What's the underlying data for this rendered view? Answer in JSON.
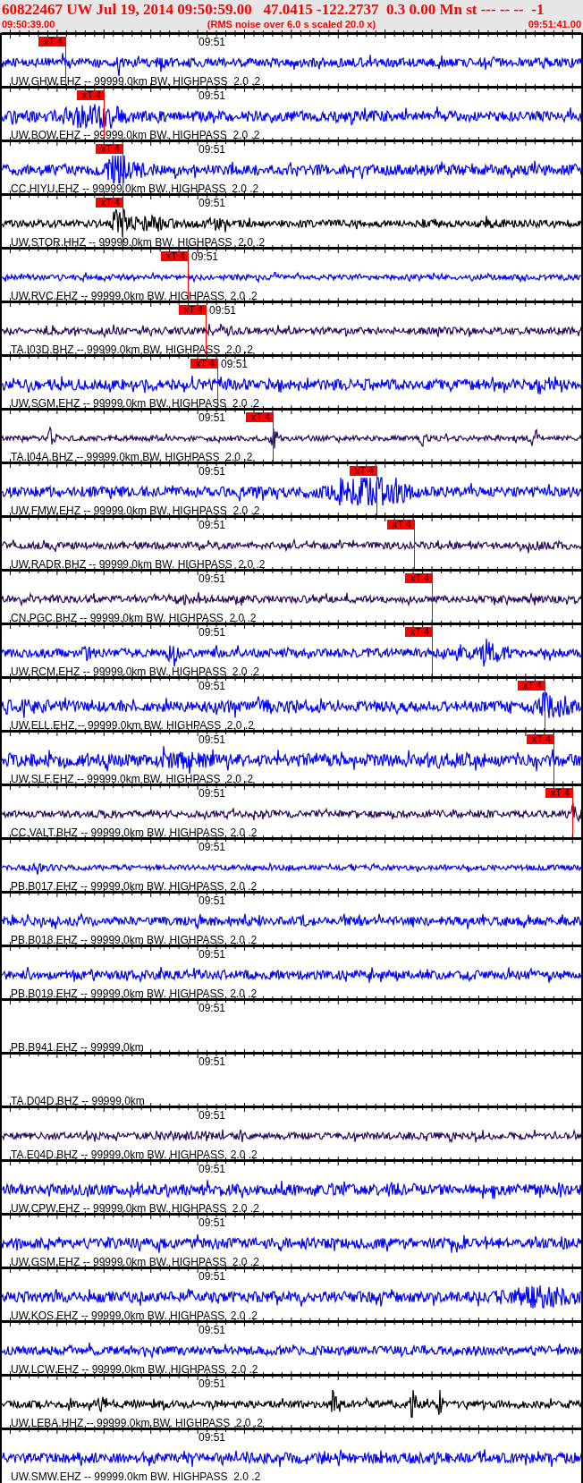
{
  "header": {
    "title": "60822467 UW Jul 19, 2014 09:50:59.00   47.0415 -122.2737  0.3 0.00 Mn st --- -- --  -1",
    "start_time": "09:50:39.00",
    "note": "(RMS noise over 6.0 s scaled 20.0 x)",
    "end_time": "09:51:41.00"
  },
  "channels": [
    {
      "label": "UW.GHW.EHZ -- 99999.0km BW. HIGHPASS  2.0 .2",
      "kind": "trace",
      "color": "#0000ff",
      "tick_label": "09:51",
      "pick": "xT 4"
    },
    {
      "label": "UW.BOW.EHZ -- 99999.0km BW. HIGHPASS  2.0 .2",
      "kind": "trace",
      "color": "#0000ff",
      "tick_label": "09:51",
      "pick": "xT 4"
    },
    {
      "label": "CC.HIYU.EHZ -- 99999.0km BW. HIGHPASS  2.0 .2",
      "kind": "trace",
      "color": "#0000ff",
      "tick_label": "09:51",
      "pick": "xT 4"
    },
    {
      "label": "UW.STOR.HHZ -- 99999.0km BW. HIGHPASS  2.0 .2",
      "kind": "trace",
      "color": "#000000",
      "tick_label": "09:51",
      "pick": "xT 4"
    },
    {
      "label": "UW.RVC.EHZ -- 99999.0km BW. HIGHPASS  2.0 .2",
      "kind": "trace",
      "color": "#0000ff",
      "tick_label": "09:51",
      "pick": "xT 4"
    },
    {
      "label": "TA.I03D.BHZ -- 99999.0km BW. HIGHPASS  2.0 .2",
      "kind": "trace",
      "color": "#2a0a5e",
      "tick_label": "09:51",
      "pick": "xT 4"
    },
    {
      "label": "UW.SGM.EHZ -- 99999.0km BW. HIGHPASS  2.0 .2",
      "kind": "trace",
      "color": "#0000ff",
      "tick_label": "09:51",
      "pick": "xT 4"
    },
    {
      "label": "TA.I04A.BHZ -- 99999.0km BW. HIGHPASS  2.0 .2",
      "kind": "trace",
      "color": "#2a0a5e",
      "tick_label": "09:51",
      "pick": "xT 4"
    },
    {
      "label": "UW.FMW.EHZ -- 99999.0km BW. HIGHPASS  2.0 .2",
      "kind": "trace",
      "color": "#0000ff",
      "tick_label": "09:51",
      "pick": "xT 4"
    },
    {
      "label": "UW.RADR.BHZ -- 99999.0km BW. HIGHPASS  2.0 .2",
      "kind": "trace",
      "color": "#2a0a5e",
      "tick_label": "09:51",
      "pick": "xT 4"
    },
    {
      "label": "CN.PGC.BHZ -- 99999.0km BW. HIGHPASS  2.0 .2",
      "kind": "trace",
      "color": "#2a0a5e",
      "tick_label": "09:51",
      "pick": "xT 4"
    },
    {
      "label": "UW.RCM.EHZ -- 99999.0km BW. HIGHPASS  2.0 .2",
      "kind": "trace",
      "color": "#0000ff",
      "tick_label": "09:51",
      "pick": "xT 4"
    },
    {
      "label": "UW.ELL.EHZ -- 99999.0km BW. HIGHPASS  2.0 .2",
      "kind": "trace",
      "color": "#0000ff",
      "tick_label": "09:51",
      "pick": "xT 4"
    },
    {
      "label": "UW.SLF.EHZ -- 99999.0km BW. HIGHPASS  2.0 .2",
      "kind": "trace",
      "color": "#0000ff",
      "tick_label": "09:51",
      "pick": "xT 4"
    },
    {
      "label": "CC.VALT.BHZ -- 99999.0km BW. HIGHPASS  2.0 .2",
      "kind": "trace",
      "color": "#2a0a5e",
      "tick_label": "09:51",
      "pick": "xT 4"
    },
    {
      "label": "PB.B017.EHZ -- 99999.0km BW. HIGHPASS  2.0 .2",
      "kind": "trace",
      "color": "#0000ff",
      "tick_label": "09:51"
    },
    {
      "label": "PB.B018.EHZ -- 99999.0km BW. HIGHPASS  2.0 .2",
      "kind": "trace",
      "color": "#0000ff",
      "tick_label": "09:51"
    },
    {
      "label": "PB.B019.EHZ -- 99999.0km BW. HIGHPASS  2.0 .2",
      "kind": "trace",
      "color": "#0000ff",
      "tick_label": "09:51"
    },
    {
      "label": "PB.B941.EHZ -- 99999.0km",
      "kind": "empty",
      "tick_label": "09:51"
    },
    {
      "label": "TA.D04D.BHZ -- 99999.0km",
      "kind": "empty",
      "tick_label": "09:51"
    },
    {
      "label": "TA.E04D.BHZ -- 99999.0km BW. HIGHPASS  2.0 .2",
      "kind": "trace",
      "color": "#2a0a5e",
      "tick_label": "09:51"
    },
    {
      "label": "UW.CPW.EHZ -- 99999.0km BW. HIGHPASS  2.0 .2",
      "kind": "trace",
      "color": "#0000ff",
      "tick_label": "09:51"
    },
    {
      "label": "UW.GSM.EHZ -- 99999.0km BW. HIGHPASS  2.0 .2",
      "kind": "trace",
      "color": "#0000ff",
      "tick_label": "09:51"
    },
    {
      "label": "UW.KOS.EHZ -- 99999.0km BW. HIGHPASS  2.0 .2",
      "kind": "trace",
      "color": "#0000ff",
      "tick_label": "09:51"
    },
    {
      "label": "UW.LCW.EHZ -- 99999.0km BW. HIGHPASS  2.0 .2",
      "kind": "trace",
      "color": "#0000ff",
      "tick_label": "09:51"
    },
    {
      "label": "UW.LEBA.HHZ -- 99999.0km BW. HIGHPASS  2.0 .2",
      "kind": "trace",
      "color": "#000000",
      "tick_label": "09:51"
    },
    {
      "label": "UW.SMW.EHZ -- 99999.0km BW. HIGHPASS  2.0 .2",
      "kind": "trace",
      "color": "#0000ff",
      "tick_label": "09:51"
    }
  ]
}
